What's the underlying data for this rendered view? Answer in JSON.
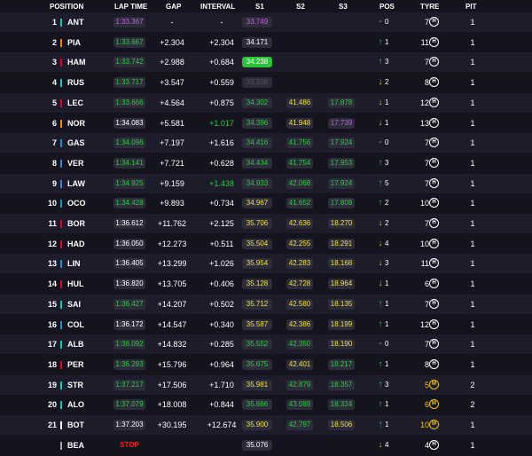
{
  "header": {
    "position": "POSITION",
    "lap_time": "LAP TIME",
    "gap": "GAP",
    "interval": "INTERVAL",
    "s1": "S1",
    "s2": "S2",
    "s3": "S3",
    "pos": "POS",
    "tyre": "TYRE",
    "pit": "PIT"
  },
  "rows": [
    {
      "pos": "1",
      "team_color": "#16c7c1",
      "driver": "ANT",
      "lap": "1:33.367",
      "lap_c": "pur",
      "gap": "-",
      "int": "-",
      "int_c": "wht",
      "s1": "33.749",
      "s1_c": "pur",
      "s2": "",
      "s2_c": "",
      "s3": "",
      "s3_c": "",
      "arrow": "-",
      "dir": "flat",
      "pch": "0",
      "tnum": "7",
      "tyre": "H",
      "tyre_color": "#ffffff",
      "pit": "1"
    },
    {
      "pos": "2",
      "team_color": "#ff8000",
      "driver": "PIA",
      "lap": "1:33.667",
      "lap_c": "grn",
      "gap": "+2.304",
      "int": "+2.304",
      "int_c": "wht",
      "s1": "34.171",
      "s1_c": "wht",
      "s2": "",
      "s2_c": "",
      "s3": "",
      "s3_c": "",
      "arrow": "↑",
      "dir": "up",
      "pch": "1",
      "tnum": "11",
      "tyre": "H",
      "tyre_color": "#ffffff",
      "pit": "1"
    },
    {
      "pos": "3",
      "team_color": "#e8002d",
      "driver": "HAM",
      "lap": "1:33.742",
      "lap_c": "grn",
      "gap": "+2.988",
      "int": "+0.684",
      "int_c": "wht",
      "s1": "34.238",
      "s1_c": "bg",
      "s2": "",
      "s2_c": "",
      "s3": "",
      "s3_c": "",
      "arrow": "↑",
      "dir": "up",
      "pch": "3",
      "tnum": "7",
      "tyre": "H",
      "tyre_color": "#ffffff",
      "pit": "1"
    },
    {
      "pos": "4",
      "team_color": "#16c7c1",
      "driver": "RUS",
      "lap": "1:33.717",
      "lap_c": "grn",
      "gap": "+3.547",
      "int": "+0.559",
      "int_c": "wht",
      "s1": "33.938",
      "s1_c": "grey",
      "s2": "",
      "s2_c": "",
      "s3": "",
      "s3_c": "",
      "arrow": "↓",
      "dir": "down",
      "pch": "2",
      "tnum": "8",
      "tyre": "H",
      "tyre_color": "#ffffff",
      "pit": "1"
    },
    {
      "pos": "5",
      "team_color": "#e8002d",
      "driver": "LEC",
      "lap": "1:33.666",
      "lap_c": "grn",
      "gap": "+4.564",
      "int": "+0.875",
      "int_c": "wht",
      "s1": "34.302",
      "s1_c": "grn",
      "s2": "41.486",
      "s2_c": "yel",
      "s3": "17.878",
      "s3_c": "grn",
      "arrow": "↓",
      "dir": "down",
      "pch": "1",
      "tnum": "12",
      "tyre": "H",
      "tyre_color": "#ffffff",
      "pit": "1"
    },
    {
      "pos": "6",
      "team_color": "#ff8000",
      "driver": "NOR",
      "lap": "1:34.083",
      "lap_c": "wht",
      "gap": "+5.581",
      "int": "+1.017",
      "int_c": "grn",
      "s1": "34.396",
      "s1_c": "grn",
      "s2": "41.948",
      "s2_c": "yel",
      "s3": "17.739",
      "s3_c": "pur",
      "arrow": "↓",
      "dir": "down",
      "pch": "1",
      "tnum": "13",
      "tyre": "H",
      "tyre_color": "#ffffff",
      "pit": "1"
    },
    {
      "pos": "7",
      "team_color": "#2293d1",
      "driver": "GAS",
      "lap": "1:34.096",
      "lap_c": "grn",
      "gap": "+7.197",
      "int": "+1.616",
      "int_c": "wht",
      "s1": "34.416",
      "s1_c": "grn",
      "s2": "41.756",
      "s2_c": "grn",
      "s3": "17.924",
      "s3_c": "grn",
      "arrow": "-",
      "dir": "flat",
      "pch": "0",
      "tnum": "7",
      "tyre": "H",
      "tyre_color": "#ffffff",
      "pit": "1"
    },
    {
      "pos": "8",
      "team_color": "#4781d7",
      "driver": "VER",
      "lap": "1:34.141",
      "lap_c": "grn",
      "gap": "+7.721",
      "int": "+0.628",
      "int_c": "wht",
      "s1": "34.434",
      "s1_c": "grn",
      "s2": "41.754",
      "s2_c": "grn",
      "s3": "17.953",
      "s3_c": "grn",
      "arrow": "↑",
      "dir": "up",
      "pch": "3",
      "tnum": "7",
      "tyre": "H",
      "tyre_color": "#ffffff",
      "pit": "1"
    },
    {
      "pos": "9",
      "team_color": "#4781d7",
      "driver": "LAW",
      "lap": "1:34.925",
      "lap_c": "grn",
      "gap": "+9.159",
      "int": "+1.438",
      "int_c": "grn",
      "s1": "34.933",
      "s1_c": "grn",
      "s2": "42.068",
      "s2_c": "grn",
      "s3": "17.924",
      "s3_c": "grn",
      "arrow": "↑",
      "dir": "up",
      "pch": "5",
      "tnum": "7",
      "tyre": "H",
      "tyre_color": "#ffffff",
      "pit": "1"
    },
    {
      "pos": "10",
      "team_color": "#2293d1",
      "driver": "OCO",
      "lap": "1:34.428",
      "lap_c": "grn",
      "gap": "+9.893",
      "int": "+0.734",
      "int_c": "wht",
      "s1": "34.967",
      "s1_c": "yel",
      "s2": "41.652",
      "s2_c": "grn",
      "s3": "17.809",
      "s3_c": "grn",
      "arrow": "↑",
      "dir": "up",
      "pch": "2",
      "tnum": "10",
      "tyre": "H",
      "tyre_color": "#ffffff",
      "pit": "1"
    },
    {
      "pos": "11",
      "team_color": "#e8002d",
      "driver": "BOR",
      "lap": "1:36.612",
      "lap_c": "wht",
      "gap": "+11.762",
      "int": "+2.125",
      "int_c": "wht",
      "s1": "35.706",
      "s1_c": "yel",
      "s2": "42.636",
      "s2_c": "yel",
      "s3": "18.270",
      "s3_c": "yel",
      "arrow": "↓",
      "dir": "down",
      "pch": "2",
      "tnum": "7",
      "tyre": "H",
      "tyre_color": "#ffffff",
      "pit": "1"
    },
    {
      "pos": "12",
      "team_color": "#e8002d",
      "driver": "HAD",
      "lap": "1:36.050",
      "lap_c": "wht",
      "gap": "+12.273",
      "int": "+0.511",
      "int_c": "wht",
      "s1": "35.504",
      "s1_c": "yel",
      "s2": "42.255",
      "s2_c": "yel",
      "s3": "18.291",
      "s3_c": "yel",
      "arrow": "↓",
      "dir": "down",
      "pch": "4",
      "tnum": "10",
      "tyre": "H",
      "tyre_color": "#ffffff",
      "pit": "1"
    },
    {
      "pos": "13",
      "team_color": "#2293d1",
      "driver": "LIN",
      "lap": "1:36.405",
      "lap_c": "wht",
      "gap": "+13.299",
      "int": "+1.026",
      "int_c": "wht",
      "s1": "35.954",
      "s1_c": "yel",
      "s2": "42.283",
      "s2_c": "yel",
      "s3": "18.168",
      "s3_c": "yel",
      "arrow": "↓",
      "dir": "down",
      "pch": "3",
      "tnum": "11",
      "tyre": "H",
      "tyre_color": "#ffffff",
      "pit": "1"
    },
    {
      "pos": "14",
      "team_color": "#e8002d",
      "driver": "HUL",
      "lap": "1:36.820",
      "lap_c": "wht",
      "gap": "+13.705",
      "int": "+0.406",
      "int_c": "wht",
      "s1": "35.128",
      "s1_c": "yel",
      "s2": "42.728",
      "s2_c": "yel",
      "s3": "18.964",
      "s3_c": "yel",
      "arrow": "↓",
      "dir": "down",
      "pch": "1",
      "tnum": "6",
      "tyre": "H",
      "tyre_color": "#ffffff",
      "pit": "1"
    },
    {
      "pos": "15",
      "team_color": "#16c7c1",
      "driver": "SAI",
      "lap": "1:36.427",
      "lap_c": "grn",
      "gap": "+14.207",
      "int": "+0.502",
      "int_c": "wht",
      "s1": "35.712",
      "s1_c": "yel",
      "s2": "42.580",
      "s2_c": "yel",
      "s3": "18.135",
      "s3_c": "yel",
      "arrow": "↑",
      "dir": "up",
      "pch": "1",
      "tnum": "7",
      "tyre": "H",
      "tyre_color": "#ffffff",
      "pit": "1"
    },
    {
      "pos": "16",
      "team_color": "#2293d1",
      "driver": "COL",
      "lap": "1:36.172",
      "lap_c": "wht",
      "gap": "+14.547",
      "int": "+0.340",
      "int_c": "wht",
      "s1": "35.587",
      "s1_c": "yel",
      "s2": "42.386",
      "s2_c": "yel",
      "s3": "18.199",
      "s3_c": "yel",
      "arrow": "↑",
      "dir": "up",
      "pch": "1",
      "tnum": "12",
      "tyre": "H",
      "tyre_color": "#ffffff",
      "pit": "1"
    },
    {
      "pos": "17",
      "team_color": "#16c7c1",
      "driver": "ALB",
      "lap": "1:36.092",
      "lap_c": "grn",
      "gap": "+14.832",
      "int": "+0.285",
      "int_c": "wht",
      "s1": "35.552",
      "s1_c": "grn",
      "s2": "42.350",
      "s2_c": "grn",
      "s3": "18.190",
      "s3_c": "yel",
      "arrow": "-",
      "dir": "flat",
      "pch": "0",
      "tnum": "7",
      "tyre": "H",
      "tyre_color": "#ffffff",
      "pit": "1"
    },
    {
      "pos": "18",
      "team_color": "#e8002d",
      "driver": "PER",
      "lap": "1:36.293",
      "lap_c": "grn",
      "gap": "+15.796",
      "int": "+0.964",
      "int_c": "wht",
      "s1": "35.675",
      "s1_c": "grn",
      "s2": "42.401",
      "s2_c": "yel",
      "s3": "18.217",
      "s3_c": "grn",
      "arrow": "↑",
      "dir": "up",
      "pch": "1",
      "tnum": "8",
      "tyre": "H",
      "tyre_color": "#ffffff",
      "pit": "1"
    },
    {
      "pos": "19",
      "team_color": "#16c7c1",
      "driver": "STR",
      "lap": "1:37.217",
      "lap_c": "grn",
      "gap": "+17.506",
      "int": "+1.710",
      "int_c": "wht",
      "s1": "35.981",
      "s1_c": "yel",
      "s2": "42.879",
      "s2_c": "grn",
      "s3": "18.357",
      "s3_c": "grn",
      "arrow": "↑",
      "dir": "up",
      "pch": "3",
      "tnum": "5",
      "tyre": "M",
      "tyre_color": "#f0c000",
      "pit": "2"
    },
    {
      "pos": "20",
      "team_color": "#16c7c1",
      "driver": "ALO",
      "lap": "1:37.079",
      "lap_c": "grn",
      "gap": "+18.008",
      "int": "+0.844",
      "int_c": "wht",
      "s1": "35.666",
      "s1_c": "grn",
      "s2": "43.089",
      "s2_c": "grn",
      "s3": "18.324",
      "s3_c": "grn",
      "arrow": "↑",
      "dir": "up",
      "pch": "1",
      "tnum": "6",
      "tyre": "M",
      "tyre_color": "#f0c000",
      "pit": "2"
    },
    {
      "pos": "21",
      "team_color": "#ffffff",
      "driver": "BOT",
      "lap": "1:37.203",
      "lap_c": "wht",
      "gap": "+30.195",
      "int": "+12.674",
      "int_c": "wht",
      "s1": "35.900",
      "s1_c": "yel",
      "s2": "42.797",
      "s2_c": "grn",
      "s3": "18.506",
      "s3_c": "yel",
      "arrow": "↑",
      "dir": "up",
      "pch": "1",
      "tnum": "10",
      "tyre": "M",
      "tyre_color": "#f0c000",
      "pit": "1"
    },
    {
      "pos": "",
      "team_color": "#aaaaaa",
      "driver": "BEA",
      "lap": "STOP",
      "lap_c": "red",
      "gap": "",
      "int": "",
      "int_c": "wht",
      "s1": "35.076",
      "s1_c": "wht",
      "s2": "",
      "s2_c": "",
      "s3": "",
      "s3_c": "",
      "arrow": "↓",
      "dir": "down",
      "pch": "4",
      "tnum": "4",
      "tyre": "H",
      "tyre_color": "#ffffff",
      "pit": "1"
    }
  ]
}
